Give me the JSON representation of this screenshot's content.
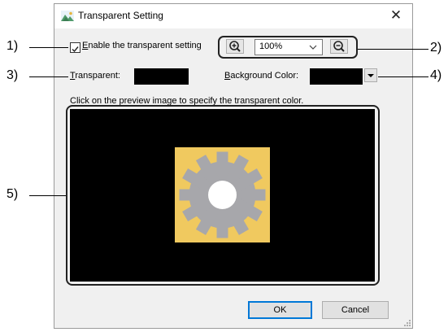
{
  "window": {
    "title": "Transparent Setting",
    "close_glyph": "✕"
  },
  "enable": {
    "label_mnemonic": "E",
    "label_rest": "nable the transparent setting",
    "checked": true
  },
  "zoom": {
    "value": "100%",
    "zoom_in_icon": "zoom-in-icon",
    "zoom_out_icon": "zoom-out-icon"
  },
  "transparent": {
    "label_mnemonic": "T",
    "label_rest": "ransparent:",
    "color": "#000000"
  },
  "background": {
    "label_mnemonic": "B",
    "label_rest": "ackground Color:",
    "color": "#000000"
  },
  "hint": "Click on the preview image to specify the transparent color.",
  "preview": {
    "background": "#000000",
    "image_bg": "#f0c95f",
    "gear_color": "#a7a7ab"
  },
  "buttons": {
    "ok": "OK",
    "cancel": "Cancel"
  },
  "callouts": [
    "1)",
    "2)",
    "3)",
    "4)",
    "5)"
  ]
}
